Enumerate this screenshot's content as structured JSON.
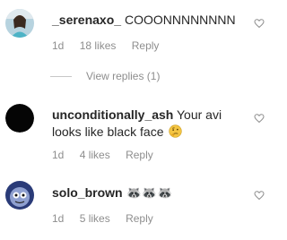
{
  "comments": [
    {
      "username": "_serenaxo_",
      "text": "COOONNNNNNNN",
      "time": "1d",
      "likes": "18 likes",
      "reply_label": "Reply",
      "view_replies": "View replies (1)",
      "avatar_icon": "user-photo-avatar"
    },
    {
      "username": "unconditionally_ash",
      "text": "Your avi looks like black face",
      "emoji": "thinking-face",
      "time": "1d",
      "likes": "4 likes",
      "reply_label": "Reply",
      "avatar_icon": "black-avatar"
    },
    {
      "username": "solo_brown",
      "text": "🦝🦝🦝",
      "time": "1d",
      "likes": "5 likes",
      "reply_label": "Reply",
      "avatar_icon": "cartoon-avatar"
    }
  ],
  "icons": {
    "like": "heart-outline-icon"
  },
  "colors": {
    "text": "#262626",
    "meta": "#8e8e8e",
    "emoji_face": "#f4c542"
  }
}
